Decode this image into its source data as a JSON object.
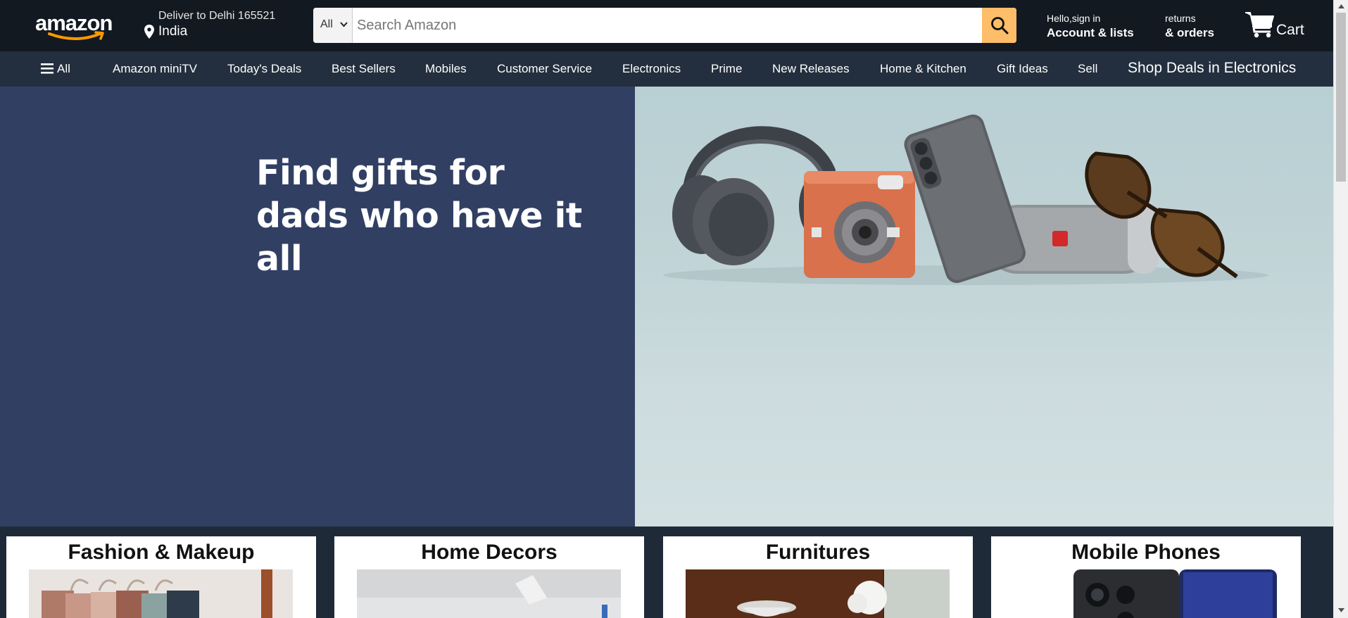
{
  "header": {
    "logo_text": "amazon",
    "deliver_line1": "Deliver to Delhi 165521",
    "deliver_line2": "India",
    "search_category": "All",
    "search_placeholder": "Search Amazon",
    "account_line1": "Hello,sign in",
    "account_line2": "Account & lists",
    "orders_line1": "returns",
    "orders_line2": "& orders",
    "cart_label": "Cart"
  },
  "subnav": {
    "all_label": "All",
    "items": [
      "Amazon miniTV",
      "Today's Deals",
      "Best Sellers",
      "Mobiles",
      "Customer Service",
      "Electronics",
      "Prime",
      "New Releases",
      "Home & Kitchen",
      "Gift Ideas",
      "Sell"
    ],
    "promo": "Shop Deals in Electronics"
  },
  "hero": {
    "headline_line1": "Find gifts for",
    "headline_line2": "dads who have it all",
    "image_products": [
      "headphones",
      "instant-camera",
      "smartphone",
      "bluetooth-speaker",
      "sunglasses"
    ]
  },
  "cards": [
    {
      "title": "Fashion & Makeup"
    },
    {
      "title": "Home Decors"
    },
    {
      "title": "Furnitures"
    },
    {
      "title": "Mobile Phones"
    }
  ],
  "colors": {
    "header_bg": "#131921",
    "subnav_bg": "#232f3e",
    "search_button": "#febd69",
    "hero_left": "#313f63",
    "hero_right": "#c1d4d7",
    "page_bg": "#1e2a37"
  }
}
